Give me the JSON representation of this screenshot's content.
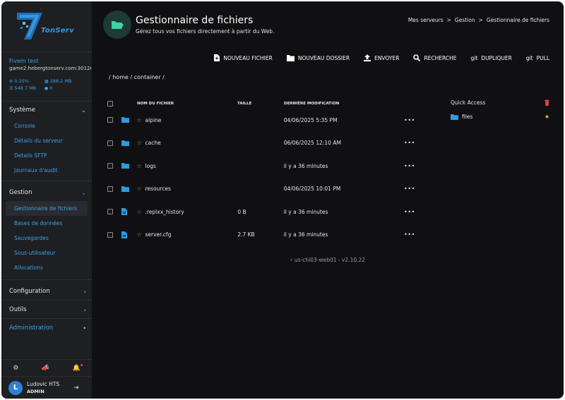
{
  "brand": {
    "logo_text": "TonServ"
  },
  "server": {
    "name": "Fivem test",
    "host": "game2.hebergtonserv.com:30120",
    "cpu": "0.25%",
    "memory": "288.2 MB",
    "disk": "548.7 MB",
    "players": "0"
  },
  "sidebar": {
    "systeme": {
      "label": "Système",
      "items": [
        "Console",
        "Détails du serveur",
        "Details SFTP",
        "Journaux d'audit"
      ]
    },
    "gestion": {
      "label": "Gestion",
      "items": [
        "Gestionnaire de fichiers",
        "Bases de données",
        "Sauvegardes",
        "Sous-utilisateur",
        "Allocations"
      ]
    },
    "configuration": "Configuration",
    "outils": "Outils",
    "administration": "Administration"
  },
  "user": {
    "name": "Ludovic HTS",
    "role": "ADMIN",
    "initial": "L"
  },
  "header": {
    "title": "Gestionnaire de fichiers",
    "subtitle": "Gérez tous vos fichiers directement à partir du Web."
  },
  "breadcrumbs": [
    "Mes serveurs",
    ">",
    "Gestion",
    ">",
    "Gestionnaire de fichiers"
  ],
  "toolbar": {
    "new_file": "NOUVEAU FICHIER",
    "new_folder": "NOUVEAU DOSSIER",
    "upload": "ENVOYER",
    "search": "RECHERCHE",
    "git_label": "git",
    "duplicate": "DUPLIQUER",
    "pull": "PULL"
  },
  "path": "/ home / container /",
  "table": {
    "headers": {
      "name": "NOM DU FICHIER",
      "size": "TAILLE",
      "modified": "DERNIÈRE MODIFICATION"
    },
    "rows": [
      {
        "type": "folder",
        "name": "alpine",
        "size": "",
        "modified": "04/06/2025 5:35 PM"
      },
      {
        "type": "folder",
        "name": "cache",
        "size": "",
        "modified": "06/06/2025 12:10 AM"
      },
      {
        "type": "folder",
        "name": "logs",
        "size": "",
        "modified": "il y a 36 minutes"
      },
      {
        "type": "folder",
        "name": "resources",
        "size": "",
        "modified": "04/06/2025 10:01 PM"
      },
      {
        "type": "file",
        "name": ".replxx_history",
        "size": "0 B",
        "modified": "il y a 36 minutes"
      },
      {
        "type": "file",
        "name": "server.cfg",
        "size": "2.7 KB",
        "modified": "il y a 36 minutes"
      }
    ]
  },
  "version": "us-chi03-web01 - v2.10.22",
  "quick_access": {
    "title": "Quick Access",
    "items": [
      {
        "name": "files"
      }
    ]
  },
  "colors": {
    "accent": "#3aa3e6",
    "folder": "#2f9be0",
    "star": "#f2c230",
    "trash": "#e04848",
    "header_icon": "#3fd6a6"
  }
}
